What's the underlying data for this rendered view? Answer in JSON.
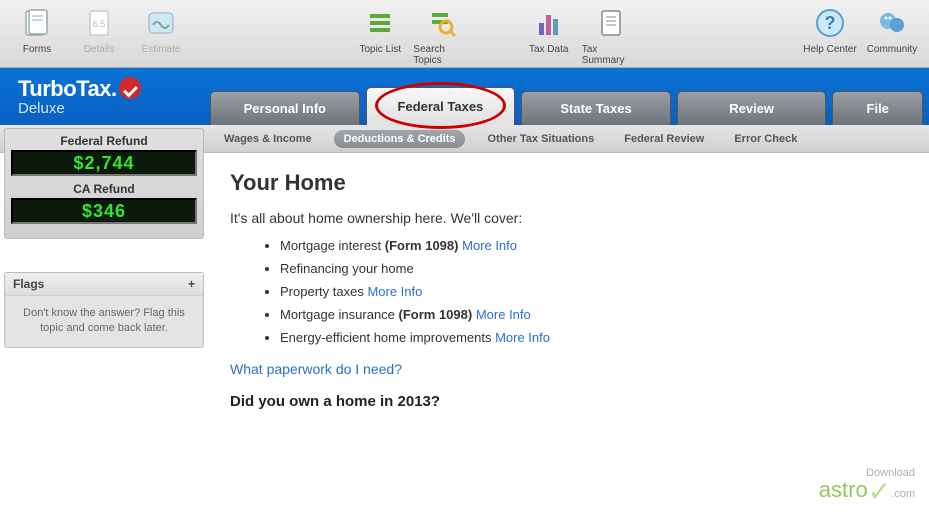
{
  "toolbar": {
    "forms": "Forms",
    "details": "Details",
    "estimate": "Estimate",
    "topic_list": "Topic List",
    "search_topics": "Search Topics",
    "tax_data": "Tax Data",
    "tax_summary": "Tax Summary",
    "help_center": "Help Center",
    "community": "Community"
  },
  "brand": {
    "line1": "TurboTax.",
    "line2": "Deluxe"
  },
  "tabs": {
    "personal": "Personal Info",
    "federal": "Federal Taxes",
    "state": "State Taxes",
    "review": "Review",
    "file": "File"
  },
  "subtabs": {
    "wages": "Wages & Income",
    "deductions": "Deductions & Credits",
    "other": "Other Tax Situations",
    "fedreview": "Federal Review",
    "error": "Error Check"
  },
  "refund": {
    "fed_label": "Federal Refund",
    "fed_value": "$2,744",
    "ca_label": "CA Refund",
    "ca_value": "$346"
  },
  "flags": {
    "title": "Flags",
    "plus": "+",
    "body": "Don't know the answer? Flag this topic and come back later."
  },
  "content": {
    "heading": "Your Home",
    "intro": "It's all about home ownership here. We'll cover:",
    "items": [
      {
        "pre": "Mortgage interest ",
        "bold": "(Form 1098)",
        "link": "More Info"
      },
      {
        "pre": "Refinancing your home",
        "bold": "",
        "link": ""
      },
      {
        "pre": "Property taxes ",
        "bold": "",
        "link": "More Info"
      },
      {
        "pre": "Mortgage insurance ",
        "bold": "(Form 1098)",
        "link": "More Info"
      },
      {
        "pre": "Energy-efficient home improvements ",
        "bold": "",
        "link": "More Info"
      }
    ],
    "paperwork": "What paperwork do I need?",
    "question": "Did you own a home in 2013?"
  },
  "watermark": {
    "dl": "Download",
    "name": "astro",
    "tld": ".com"
  }
}
